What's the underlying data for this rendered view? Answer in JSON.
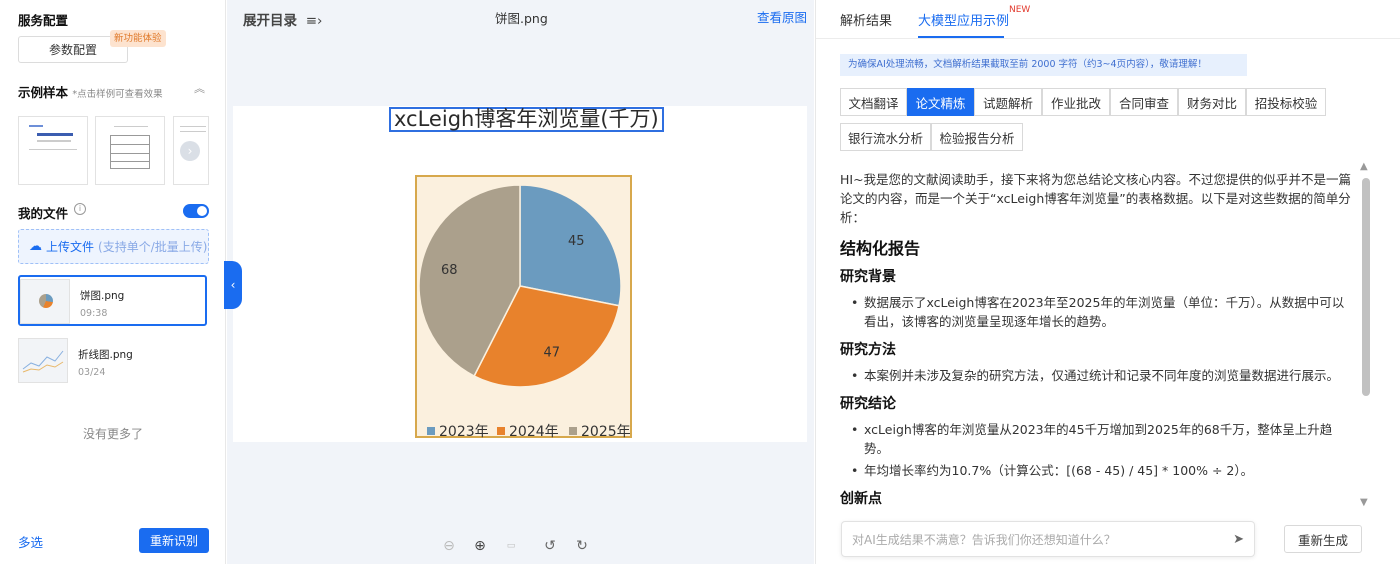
{
  "left": {
    "service_title": "服务配置",
    "param_button": "参数配置",
    "new_feature_tag": "新功能体验",
    "samples_title": "示例样本",
    "samples_hint": "*点击样例可查看效果",
    "my_files_title": "我的文件",
    "upload_label": "上传文件",
    "upload_sub": "(支持单个/批量上传)",
    "files": [
      {
        "name": "饼图.png",
        "date": "09:38"
      },
      {
        "name": "折线图.png",
        "date": "03/24"
      }
    ],
    "no_more": "没有更多了",
    "multi_select": "多选",
    "reidentify_button": "重新识别"
  },
  "center": {
    "toc_label": "展开目录",
    "file_name": "饼图.png",
    "view_original": "查看原图"
  },
  "chart_data": {
    "type": "pie",
    "title": "xcLeigh博客年浏览量(千万)",
    "categories": [
      "2023年",
      "2024年",
      "2025年"
    ],
    "values": [
      45,
      47,
      68
    ],
    "colors": [
      "#6b9bbf",
      "#e8822c",
      "#aba08c"
    ],
    "legend": "bottom"
  },
  "right": {
    "tabs": [
      "解析结果",
      "大模型应用示例"
    ],
    "new_badge": "NEW",
    "notice": "为确保AI处理流畅，文档解析结果截取至前 2000 字符（约3~4页内容），敬请理解！",
    "categories": [
      "文档翻译",
      "论文精炼",
      "试题解析",
      "作业批改",
      "合同审查",
      "财务对比",
      "招投标校验",
      "银行流水分析",
      "检验报告分析"
    ],
    "intro": "HI~我是您的文献阅读助手，接下来将为您总结论文核心内容。不过您提供的似乎并不是一篇论文的内容，而是一个关于“xcLeigh博客年浏览量”的表格数据。以下是对这些数据的简单分析：",
    "report_title": "结构化报告",
    "sections": [
      {
        "title": "研究背景",
        "items": [
          "数据展示了xcLeigh博客在2023年至2025年的年浏览量（单位：千万）。从数据中可以看出，该博客的浏览量呈现逐年增长的趋势。"
        ]
      },
      {
        "title": "研究方法",
        "items": [
          "本案例并未涉及复杂的研究方法，仅通过统计和记录不同年度的浏览量数据进行展示。"
        ]
      },
      {
        "title": "研究结论",
        "items": [
          "xcLeigh博客的年浏览量从2023年的45千万增加到2025年的68千万，整体呈上升趋势。",
          "年均增长率约为10.7%（计算公式：[(68 - 45) / 45] * 100% ÷ 2）。"
        ]
      },
      {
        "title": "创新点",
        "items": []
      }
    ],
    "input_placeholder": "对AI生成结果不满意？告诉我们你还想知道什么？",
    "regenerate_button": "重新生成"
  }
}
